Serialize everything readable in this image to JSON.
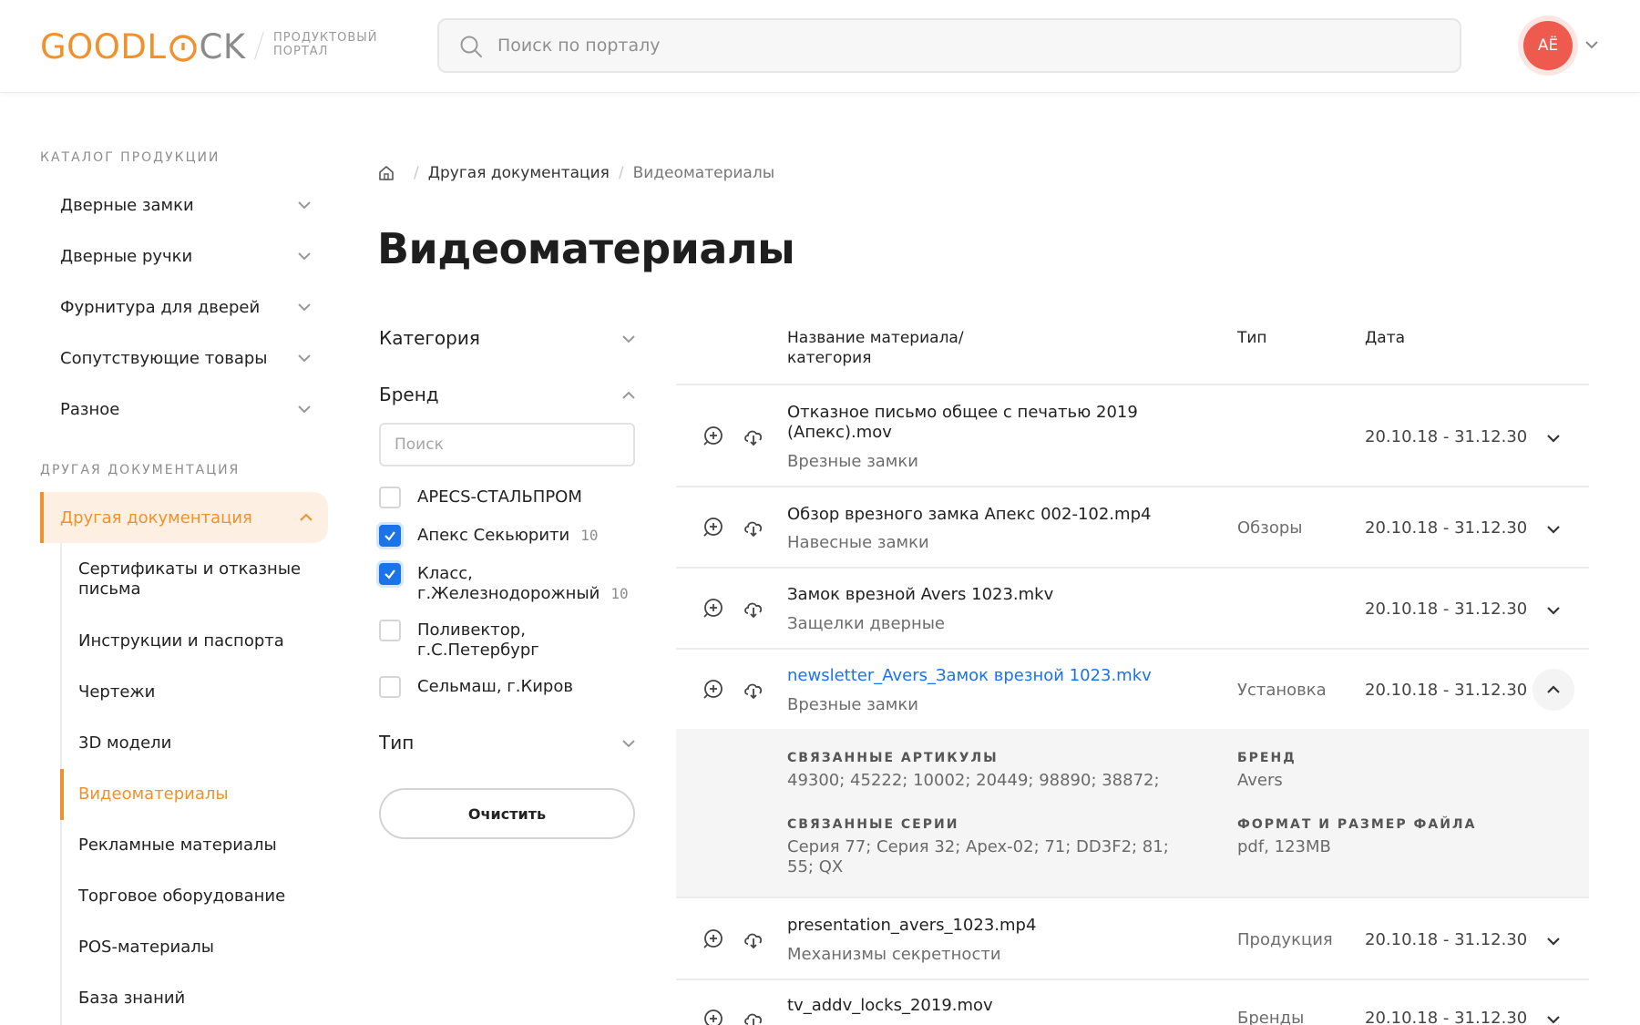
{
  "header": {
    "logo_good": "GOODL",
    "logo_lock": "CK",
    "logo_subtitle_1": "ПРОДУКТОВЫЙ",
    "logo_subtitle_2": "ПОРТАЛ",
    "search_placeholder": "Поиск по порталу",
    "avatar_initials": "АЁ",
    "colors": {
      "brand_orange": "#f0912d",
      "avatar": "#ee5a4d",
      "link_blue": "#1a73e8"
    }
  },
  "sidebar": {
    "catalog_title": "КАТАЛОГ ПРОДУКЦИИ",
    "catalog_items": [
      {
        "label": "Дверные замки"
      },
      {
        "label": "Дверные ручки"
      },
      {
        "label": "Фурнитура для дверей"
      },
      {
        "label": "Сопутствующие товары"
      },
      {
        "label": "Разное"
      }
    ],
    "docs_title": "ДРУГАЯ ДОКУМЕНТАЦИЯ",
    "active_item": "Другая документация",
    "sub_items": [
      {
        "label": "Сертификаты и отказные письма"
      },
      {
        "label": "Инструкции и паспорта"
      },
      {
        "label": "Чертежи"
      },
      {
        "label": "3D модели"
      },
      {
        "label": "Видеоматериалы"
      },
      {
        "label": "Рекламные материалы"
      },
      {
        "label": "Торговое оборудование"
      },
      {
        "label": "POS-материалы"
      },
      {
        "label": "База знаний"
      }
    ]
  },
  "breadcrumb": {
    "parent": "Другая документация",
    "current": "Видеоматериалы"
  },
  "page_title": "Видеоматериалы",
  "filters": {
    "category_label": "Категория",
    "brand_label": "Бренд",
    "brand_search_placeholder": "Поиск",
    "brands": [
      {
        "name": "APECS-СТАЛЬПРОМ",
        "checked": false,
        "count": ""
      },
      {
        "name": "Апекс Секьюрити",
        "checked": true,
        "count": "10"
      },
      {
        "name": "Класс, г.Железнодорожный",
        "checked": true,
        "count": "10"
      },
      {
        "name": "Поливектор, г.С.Петербург",
        "checked": false,
        "count": ""
      },
      {
        "name": "Сельмаш, г.Киров",
        "checked": false,
        "count": ""
      }
    ],
    "type_label": "Тип",
    "clear_button": "Очистить"
  },
  "table": {
    "headers": {
      "name": "Название материала/ категория",
      "type": "Тип",
      "date": "Дата"
    },
    "rows": [
      {
        "title": "Отказное письмо общее с печатью 2019 (Апекс).mov",
        "category": "Врезные замки",
        "type": "",
        "date": "20.10.18 - 31.12.30"
      },
      {
        "title": "Обзор врезного замка Апекс 002-102.mp4",
        "category": "Навесные замки",
        "type": "Обзоры",
        "date": "20.10.18 - 31.12.30"
      },
      {
        "title": "Замок врезной Avers 1023.mkv",
        "category": "Защелки дверные",
        "type": "",
        "date": "20.10.18 - 31.12.30"
      },
      {
        "title": "newsletter_Avers_Замок врезной 1023.mkv",
        "category": "Врезные замки",
        "type": "Установка",
        "date": "20.10.18 - 31.12.30"
      },
      {
        "title": "presentation_avers_1023.mp4",
        "category": "Механизмы секретности",
        "type": "Продукция",
        "date": "20.10.18 - 31.12.30"
      },
      {
        "title": "tv_addv_locks_2019.mov",
        "category": "",
        "type": "Бренды",
        "date": "20.10.18 - 31.12.30"
      }
    ],
    "expanded": {
      "articles_label": "СВЯЗАННЫЕ АРТИКУЛЫ",
      "articles_value": "49300; 45222; 10002; 20449; 98890; 38872;",
      "series_label": "СВЯЗАННЫЕ СЕРИИ",
      "series_value": "Серия 77; Серия 32; Apex-02; 71; DD3F2; 81; 55; QX",
      "brand_label": "БРЕНД",
      "brand_value": "Avers",
      "format_label": "ФОРМАТ И РАЗМЕР ФАЙЛА",
      "format_value": "pdf, 123MB"
    }
  }
}
